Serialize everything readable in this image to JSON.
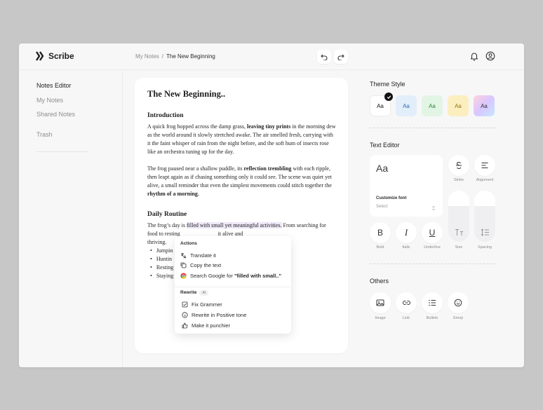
{
  "app": {
    "name": "Scribe"
  },
  "breadcrumb": {
    "parent": "My Notes",
    "separator": "/",
    "current": "The New Beginning"
  },
  "sidebar": {
    "items": [
      {
        "label": "Notes Editor",
        "active": true
      },
      {
        "label": "My Notes",
        "active": false
      },
      {
        "label": "Shared Notes",
        "active": false
      },
      {
        "label": "Trash",
        "active": false
      }
    ]
  },
  "doc": {
    "title": "The New Beginning..",
    "intro_heading": "Introduction",
    "intro_p1_a": "A quick frog hopped across the damp grass, ",
    "intro_p1_b": "leaving tiny prints",
    "intro_p1_c": " in the morning dew as the world around it slowly stretched awake. The air smelled fresh, carrying with it the faint whisper of rain from the night before, and the soft hum of insects rose like an orchestra tuning up for the day.",
    "intro_p2_a": "The frog paused near a shallow puddle, its ",
    "intro_p2_b": "reflection trembling",
    "intro_p2_c": " with each ripple, then leapt again as if chasing something only it could see. The scene was quiet yet alive, a small reminder that even the simplest movements could stitch together the ",
    "intro_p2_d": "rhythm of a morning.",
    "routine_heading": "Daily Routine",
    "routine_p_a": "The frog’s day is ",
    "routine_p_hl": "filled with small yet meaningful activities.",
    "routine_p_b": " From searching for food to resting",
    "routine_p_c": "it alive and",
    "routine_p_d": "thriving.",
    "bullets": [
      "Jumpin",
      "Huntin",
      "Resting",
      "Staying"
    ]
  },
  "popup": {
    "actions_label": "Actions",
    "actions": [
      "Translate it",
      "Copy the text"
    ],
    "search_prefix": "Search Google for ",
    "search_query": "\"filled with small..\"",
    "rewrite_label": "Rewrite",
    "ai_badge": "AI",
    "rewrite_items": [
      "Fix Grammer",
      "Rewrite in Positive tone",
      "Make it punchier"
    ]
  },
  "theme": {
    "title": "Theme Style",
    "swatches": [
      {
        "label": "Aa",
        "bg": "#ffffff",
        "fg": "#111111",
        "selected": true
      },
      {
        "label": "Aa",
        "bg": "#e3eefb",
        "fg": "#2f6fb3",
        "selected": false
      },
      {
        "label": "Aa",
        "bg": "#e2f5e4",
        "fg": "#2e8a3e",
        "selected": false
      },
      {
        "label": "Aa",
        "bg": "#fbefc0",
        "fg": "#9a7410",
        "selected": false
      },
      {
        "label": "Aa",
        "bg": "linear-gradient(135deg,#ffd1dc,#d8c7ff,#c7e6ff)",
        "fg": "#333333",
        "selected": false
      }
    ]
  },
  "text_editor": {
    "title": "Text Editor",
    "font_preview": "Aa",
    "customize_font": "Customize font",
    "select_placeholder": "Select",
    "strike": "Strike",
    "alignment": "Alignment",
    "bold": "Bold",
    "bold_glyph": "B",
    "italic": "Italic",
    "italic_glyph": "I",
    "underline": "Underline",
    "underline_glyph": "U",
    "size": "Size",
    "spacing": "Spacing",
    "size_level": 0.7,
    "spacing_level": 0.7
  },
  "others": {
    "title": "Others",
    "image": "Image",
    "link": "Link",
    "bullets": "Bullets",
    "emoji": "Emoji"
  }
}
